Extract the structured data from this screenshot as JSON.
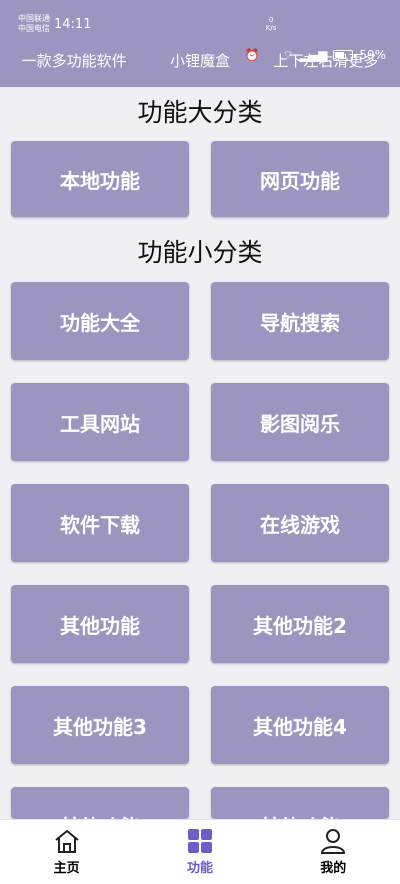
{
  "status_bar": {
    "carrier_1": "中国联通",
    "carrier_2": "中国电信",
    "time": "14:11",
    "speed_value": "0",
    "speed_unit": "K/s",
    "battery": "59%"
  },
  "marquee": [
    "一款多功能软件",
    "小锂魔盒",
    "上下左右滑更多"
  ],
  "sections": {
    "large": "功能大分类",
    "small": "功能小分类"
  },
  "large_categories": [
    "本地功能",
    "网页功能"
  ],
  "small_categories": [
    "功能大全",
    "导航搜索",
    "工具网站",
    "影图阅乐",
    "软件下载",
    "在线游戏",
    "其他功能",
    "其他功能2",
    "其他功能3",
    "其他功能4",
    "其他功能",
    "其他功能"
  ],
  "nav": [
    {
      "label": "主页",
      "icon": "home-icon"
    },
    {
      "label": "功能",
      "icon": "grid-icon"
    },
    {
      "label": "我的",
      "icon": "user-icon"
    }
  ],
  "colors": {
    "accent": "#9b95c0",
    "active_tab": "#6c5fc7",
    "background": "#f0eff4"
  }
}
